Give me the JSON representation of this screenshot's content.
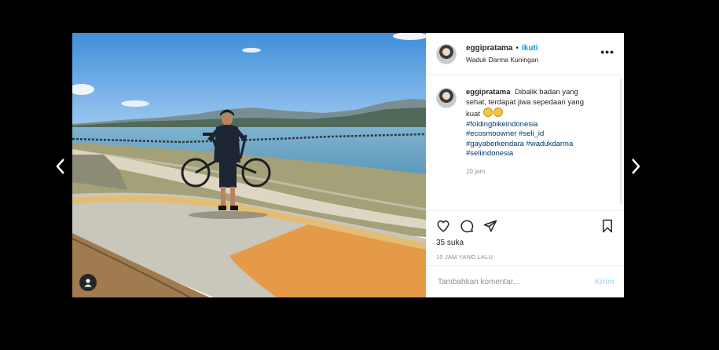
{
  "post": {
    "username": "eggipratama",
    "separator": "•",
    "follow_label": "Ikuti",
    "location": "Waduk Darma Kuningan",
    "more_label": "•••"
  },
  "caption": {
    "username": "eggipratama",
    "text": "Dibalik badan yang sehat, terdapat jiwa sepedaan yang kuat",
    "hashtags": [
      "#foldingbikeindonesia",
      "#ecosmoowner #seli_id",
      "#gayaberkendara #wadukdarma",
      "#seliindonesia"
    ],
    "time": "10 jam"
  },
  "actions": {
    "likes": "35 suka",
    "ago": "10 JAM YANG LALU"
  },
  "comment": {
    "placeholder": "Tambahkan komentar...",
    "post_label": "Kirim"
  },
  "colors": {
    "link_blue": "#0095f6",
    "hashtag": "#00376b",
    "muted": "#8e8e8e"
  },
  "icons": [
    "chevron-left-icon",
    "chevron-right-icon",
    "heart-icon",
    "comment-icon",
    "share-icon",
    "bookmark-icon",
    "user-tag-icon",
    "more-icon"
  ]
}
